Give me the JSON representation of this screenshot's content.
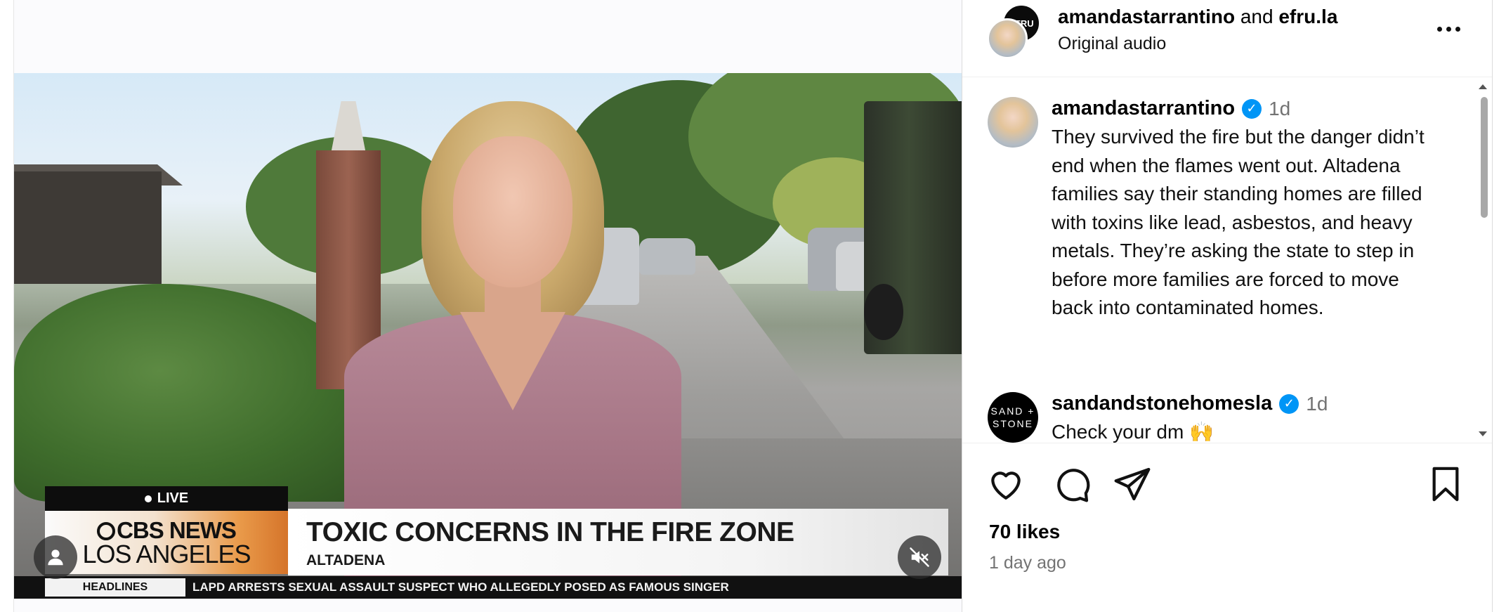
{
  "video": {
    "live_label": "LIVE",
    "brand_line1": "CBS NEWS",
    "brand_line2": "LOS ANGELES",
    "headline": "TOXIC CONCERNS IN THE FIRE ZONE",
    "subheadline": "ALTADENA",
    "ticker_label": "HEADLINES",
    "ticker_text": "LAPD ARRESTS SEXUAL ASSAULT SUSPECT WHO ALLEGEDLY POSED AS FAMOUS SINGER",
    "user_icon": "person-icon",
    "mute_icon": "speaker-muted-icon"
  },
  "header": {
    "user1": "amandastarrantino",
    "joiner": "and",
    "user2": "efru.la",
    "audio": "Original audio",
    "efru_avatar_text": "EFRU",
    "more_icon": "more-horizontal-icon"
  },
  "comments": [
    {
      "username": "amandastarrantino",
      "verified": true,
      "time": "1d",
      "text": "They survived the fire but the danger didn’t end when the flames went out. Altadena families say their standing homes are filled with toxins like lead, asbestos, and heavy metals.  They’re asking the state to step in before more families are forced to move back into contaminated homes."
    },
    {
      "username": "sandandstonehomesla",
      "verified": true,
      "time": "1d",
      "text": "Check your dm 🙌",
      "avatar_text_1": "SAND +",
      "avatar_text_2": "STONE"
    }
  ],
  "actions": {
    "like_icon": "heart-icon",
    "comment_icon": "comment-bubble-icon",
    "share_icon": "paper-plane-icon",
    "save_icon": "bookmark-icon",
    "likes": "70 likes",
    "posted": "1 day ago"
  },
  "colors": {
    "verified": "#0095f6",
    "secondary_text": "#737373",
    "border": "#dbdbdb"
  }
}
